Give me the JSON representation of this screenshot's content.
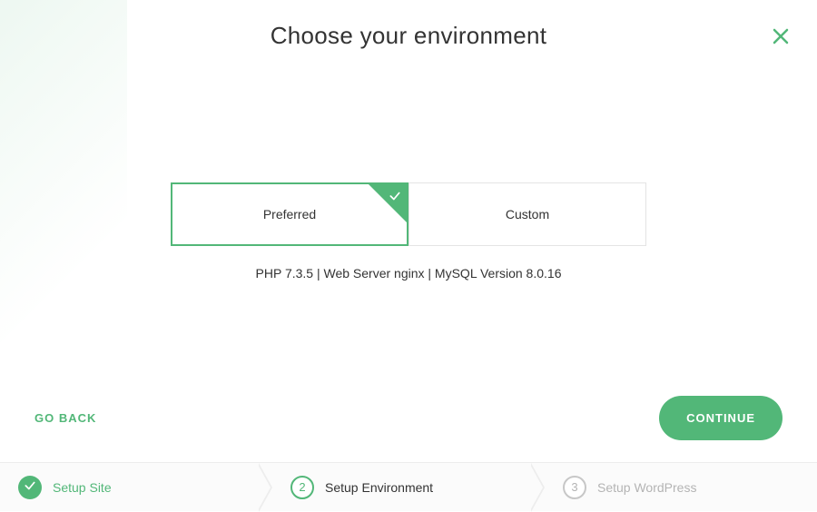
{
  "header": {
    "title": "Choose your environment"
  },
  "options": {
    "preferred_label": "Preferred",
    "custom_label": "Custom"
  },
  "env_details": "PHP 7.3.5 | Web Server nginx | MySQL Version 8.0.16",
  "actions": {
    "go_back_label": "GO BACK",
    "continue_label": "CONTINUE"
  },
  "stepper": {
    "steps": [
      {
        "label": "Setup Site",
        "state": "done"
      },
      {
        "number": "2",
        "label": "Setup Environment",
        "state": "current"
      },
      {
        "number": "3",
        "label": "Setup WordPress",
        "state": "upcoming"
      }
    ]
  },
  "colors": {
    "accent": "#52b778"
  }
}
